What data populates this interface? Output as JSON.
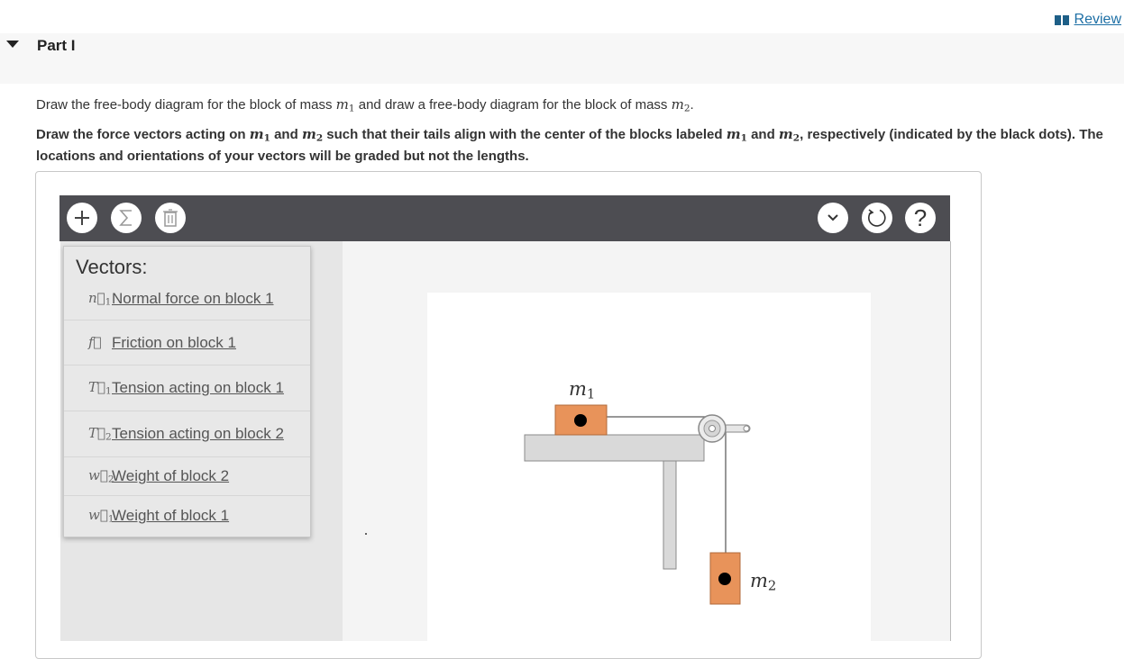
{
  "header": {
    "review_label": "Review"
  },
  "part": {
    "title": "Part I"
  },
  "instructions": {
    "line1_a": "Draw the free-body diagram for the block of mass ",
    "line1_b": " and draw a free-body diagram for the block of mass ",
    "line1_c": ".",
    "line2_a": "Draw the force vectors acting on ",
    "line2_b": " and ",
    "line2_c": " such that their tails align with the center of the blocks labeled ",
    "line2_d": " and ",
    "line2_e": ", respectively (indicated by the black dots). The locations and orientations of your vectors will be graded but not the lengths.",
    "m_symbol": "m",
    "sub1": "1",
    "sub2": "2"
  },
  "toolbar": {
    "add_icon": "plus-icon",
    "sum_icon": "sigma-icon",
    "delete_icon": "trash-icon",
    "dropdown_icon": "chevron-down-icon",
    "reset_icon": "reset-icon",
    "help_label": "?"
  },
  "vectors_menu": {
    "title": "Vectors:",
    "items": [
      {
        "symbol": "n⃗",
        "sub": "1",
        "label": "Normal force on block 1"
      },
      {
        "symbol": "f⃗",
        "sub": "",
        "label": "Friction on block 1"
      },
      {
        "symbol": "T⃗",
        "sub": "1",
        "label": "Tension acting on block 1"
      },
      {
        "symbol": "T⃗",
        "sub": "2",
        "label": "Tension acting on block 2"
      },
      {
        "symbol": "w⃗",
        "sub": "2",
        "label": "Weight of block 2"
      },
      {
        "symbol": "w⃗",
        "sub": "1",
        "label": "Weight of block 1"
      }
    ]
  },
  "diagram": {
    "label_m1": "m",
    "label_m1_sub": "1",
    "label_m2": "m",
    "label_m2_sub": "2",
    "block_color": "#e8935a",
    "table_color": "#d9d9d9"
  }
}
